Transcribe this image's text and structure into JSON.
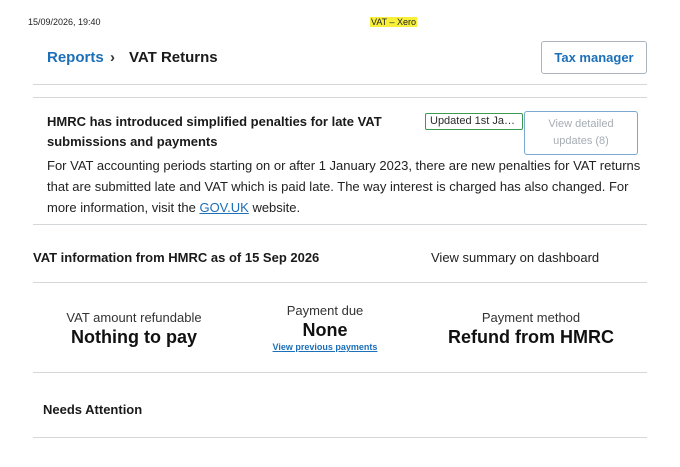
{
  "window": {
    "timestamp": "15/09/2026, 19:40",
    "title": "VAT – Xero"
  },
  "header": {
    "breadcrumb_parent": "Reports",
    "breadcrumb_separator": "›",
    "breadcrumb_current": "VAT Returns",
    "tax_manager_label": "Tax manager"
  },
  "notice": {
    "title": "HMRC has introduced simplified penalties for late VAT submissions and payments",
    "updated_badge": "Updated 1st Ja…",
    "view_updates_label": "View detailed updates (8)",
    "body_before_link": "For VAT accounting periods starting on or after 1 January 2023, there are new penalties for VAT returns that are submitted late and VAT which is paid late. The way interest is charged has also changed. For more information, visit the ",
    "link_text": "GOV.UK",
    "body_after_link": " website."
  },
  "info": {
    "heading": "VAT information from HMRC as of 15 Sep 2026",
    "summary_link": "View summary on dashboard"
  },
  "stats": {
    "refundable_label": "VAT amount refundable",
    "refundable_value": "Nothing to pay",
    "payment_due_label": "Payment due",
    "payment_due_value": "None",
    "view_previous_payments": "View previous payments",
    "payment_method_label": "Payment method",
    "payment_method_value": "Refund from HMRC"
  },
  "needs_attention": {
    "heading": "Needs Attention"
  },
  "colors": {
    "link": "#1c6fb8",
    "badge_border": "#3a9a4f",
    "title_highlight": "#f7ef3a",
    "divider": "#d4d7da"
  }
}
